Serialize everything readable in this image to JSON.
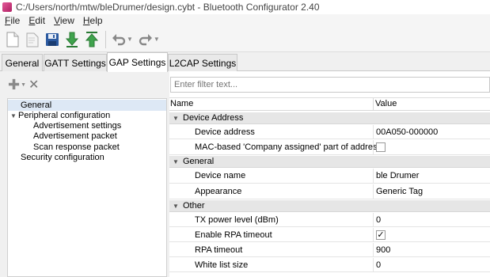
{
  "window": {
    "title": "C:/Users/north/mtw/bleDrumer/design.cybt - Bluetooth Configurator 2.40"
  },
  "menu": [
    {
      "underline": "F",
      "rest": "ile"
    },
    {
      "underline": "E",
      "rest": "dit"
    },
    {
      "underline": "V",
      "rest": "iew"
    },
    {
      "underline": "H",
      "rest": "elp"
    }
  ],
  "toolbar": {
    "icons": [
      "new-file-icon",
      "open-file-icon",
      "save-icon",
      "import-icon",
      "export-icon",
      "undo-icon",
      "redo-icon"
    ]
  },
  "tabs": [
    {
      "label": "General",
      "active": false
    },
    {
      "label": "GATT Settings",
      "active": false
    },
    {
      "label": "GAP Settings",
      "active": true
    },
    {
      "label": "L2CAP Settings",
      "active": false
    }
  ],
  "tree": {
    "items": [
      {
        "label": "General",
        "level": 0,
        "selected": true,
        "expandable": false
      },
      {
        "label": "Peripheral configuration",
        "level": 0,
        "selected": false,
        "expandable": true
      },
      {
        "label": "Advertisement settings",
        "level": 1,
        "selected": false,
        "expandable": false
      },
      {
        "label": "Advertisement packet",
        "level": 1,
        "selected": false,
        "expandable": false
      },
      {
        "label": "Scan response packet",
        "level": 1,
        "selected": false,
        "expandable": false
      },
      {
        "label": "Security configuration",
        "level": 0,
        "selected": false,
        "expandable": false
      }
    ]
  },
  "filter": {
    "placeholder": "Enter filter text..."
  },
  "grid": {
    "col_name": "Name",
    "col_value": "Value",
    "groups": [
      {
        "label": "Device Address",
        "rows": [
          {
            "name": "Device address",
            "value": "00A050-000000",
            "type": "text"
          },
          {
            "name": "MAC-based 'Company assigned' part of address",
            "value": "",
            "type": "checkbox",
            "checked": false
          }
        ]
      },
      {
        "label": "General",
        "rows": [
          {
            "name": "Device name",
            "value": "ble Drumer",
            "type": "text"
          },
          {
            "name": "Appearance",
            "value": "Generic Tag",
            "type": "text"
          }
        ]
      },
      {
        "label": "Other",
        "rows": [
          {
            "name": "TX power level (dBm)",
            "value": "0",
            "type": "text"
          },
          {
            "name": "Enable RPA timeout",
            "value": "",
            "type": "checkbox",
            "checked": true
          },
          {
            "name": "RPA timeout",
            "value": "900",
            "type": "text"
          },
          {
            "name": "White list size",
            "value": "0",
            "type": "text"
          }
        ]
      }
    ]
  }
}
